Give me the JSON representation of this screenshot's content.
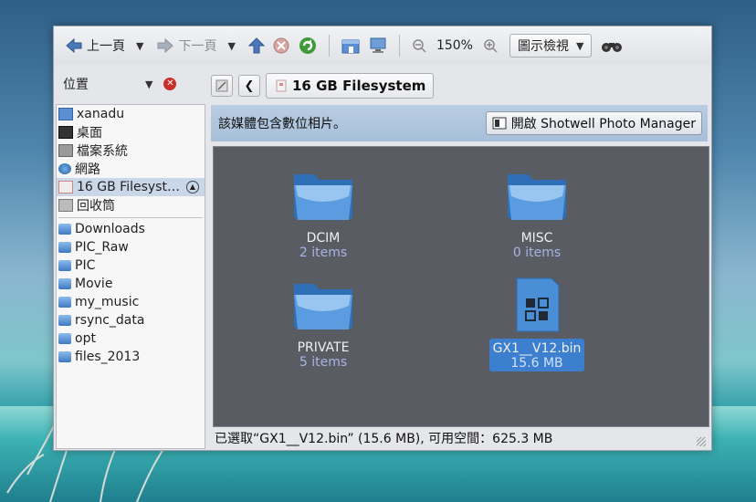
{
  "toolbar": {
    "back_label": "上一頁",
    "forward_label": "下一頁",
    "zoom_level": "150%",
    "view_mode": "圖示檢視"
  },
  "places": {
    "header": "位置",
    "items": [
      {
        "label": "xanadu",
        "icon": "home-icon"
      },
      {
        "label": "桌面",
        "icon": "desktop-icon"
      },
      {
        "label": "檔案系統",
        "icon": "drive-icon"
      },
      {
        "label": "網路",
        "icon": "network-icon"
      },
      {
        "label": "16 GB Filesyst…",
        "icon": "usb-drive-icon"
      },
      {
        "label": "回收筒",
        "icon": "trash-icon"
      }
    ],
    "bookmarks": [
      {
        "label": "Downloads"
      },
      {
        "label": "PIC_Raw"
      },
      {
        "label": "PIC"
      },
      {
        "label": "Movie"
      },
      {
        "label": "my_music"
      },
      {
        "label": "rsync_data"
      },
      {
        "label": "opt"
      },
      {
        "label": "files_2013"
      }
    ]
  },
  "location": {
    "crumb": "16 GB Filesystem"
  },
  "infobar": {
    "message": "該媒體包含數位相片。",
    "open_button": "開啟 Shotwell Photo Manager"
  },
  "files": [
    {
      "name": "DCIM",
      "meta": "2 items",
      "type": "folder"
    },
    {
      "name": "MISC",
      "meta": "0 items",
      "type": "folder"
    },
    {
      "name": "PRIVATE",
      "meta": "5 items",
      "type": "folder"
    },
    {
      "name": "GX1__V12.bin",
      "meta": "15.6 MB",
      "type": "binary"
    }
  ],
  "status": {
    "text": "已選取“GX1__V12.bin” (15.6 MB), 可用空間：625.3 MB"
  },
  "colors": {
    "selection": "#3c7fce",
    "infobar": "#b0c6de",
    "meta_text": "#a8b4e6"
  }
}
